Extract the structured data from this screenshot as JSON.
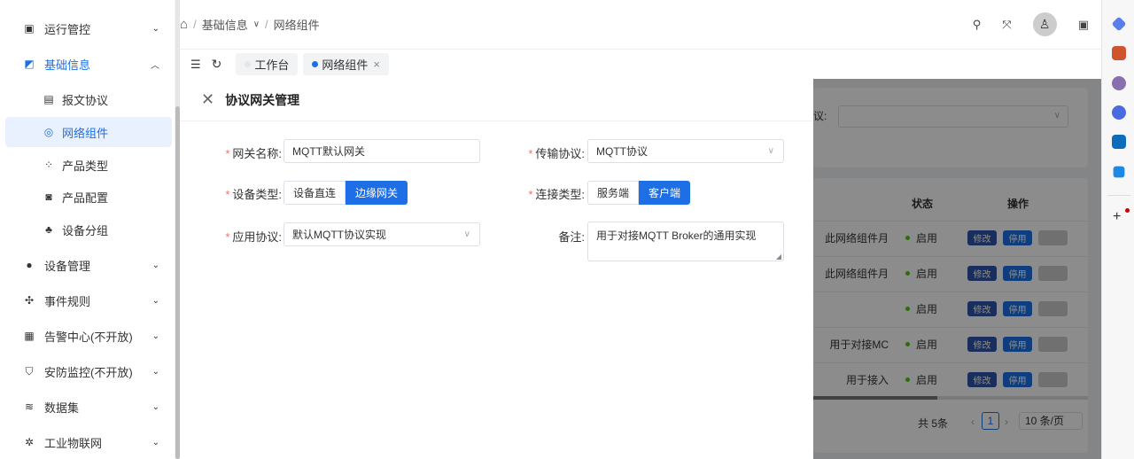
{
  "sidebar": {
    "items": [
      {
        "label": "运行管控",
        "icon": "monitor-icon"
      },
      {
        "label": "基础信息",
        "icon": "info-icon"
      },
      {
        "label": "报文协议",
        "icon": "document-icon"
      },
      {
        "label": "网络组件",
        "icon": "network-icon"
      },
      {
        "label": "产品类型",
        "icon": "grid-icon"
      },
      {
        "label": "产品配置",
        "icon": "config-icon"
      },
      {
        "label": "设备分组",
        "icon": "hierarchy-icon"
      },
      {
        "label": "设备管理",
        "icon": "device-icon"
      },
      {
        "label": "事件规则",
        "icon": "rule-icon"
      },
      {
        "label": "告警中心(不开放)",
        "icon": "alarm-icon"
      },
      {
        "label": "安防监控(不开放)",
        "icon": "shield-icon"
      },
      {
        "label": "数据集",
        "icon": "layers-icon"
      },
      {
        "label": "工业物联网",
        "icon": "iot-icon"
      }
    ]
  },
  "breadcrumb": {
    "home": "⌂",
    "sep": "/",
    "level1": "基础信息",
    "level2": "网络组件"
  },
  "tabs": [
    {
      "label": "工作台"
    },
    {
      "label": "网络组件"
    }
  ],
  "drawer": {
    "title": "协议网关管理",
    "fields": {
      "gateway_name_label": "网关名称:",
      "gateway_name": "MQTT默认网关",
      "transport_label": "传输协议:",
      "transport": "MQTT协议",
      "device_type_label": "设备类型:",
      "device_type_options": [
        "设备直连",
        "边缘网关"
      ],
      "conn_type_label": "连接类型:",
      "conn_type_options": [
        "服务端",
        "客户端"
      ],
      "app_protocol_label": "应用协议:",
      "app_protocol": "默认MQTT协议实现",
      "remark_label": "备注:",
      "remark": "用于对接MQTT Broker的通用实现"
    }
  },
  "background": {
    "filter_label": "议:",
    "table": {
      "headers": [
        "状态",
        "操作"
      ],
      "rows": [
        {
          "desc": "此网络组件月",
          "status": "启用"
        },
        {
          "desc": "此网络组件月",
          "status": "启用"
        },
        {
          "desc": "",
          "status": "启用"
        },
        {
          "desc": "用于对接MC",
          "status": "启用"
        },
        {
          "desc": "用于接入",
          "status": "启用"
        }
      ],
      "actions": [
        "修改",
        "停用"
      ]
    },
    "pagination": {
      "total": "共 5条",
      "page": "1",
      "page_size": "10 条/页"
    }
  },
  "colors": {
    "primary": "#1e6fe6",
    "required": "#f56c6c"
  }
}
